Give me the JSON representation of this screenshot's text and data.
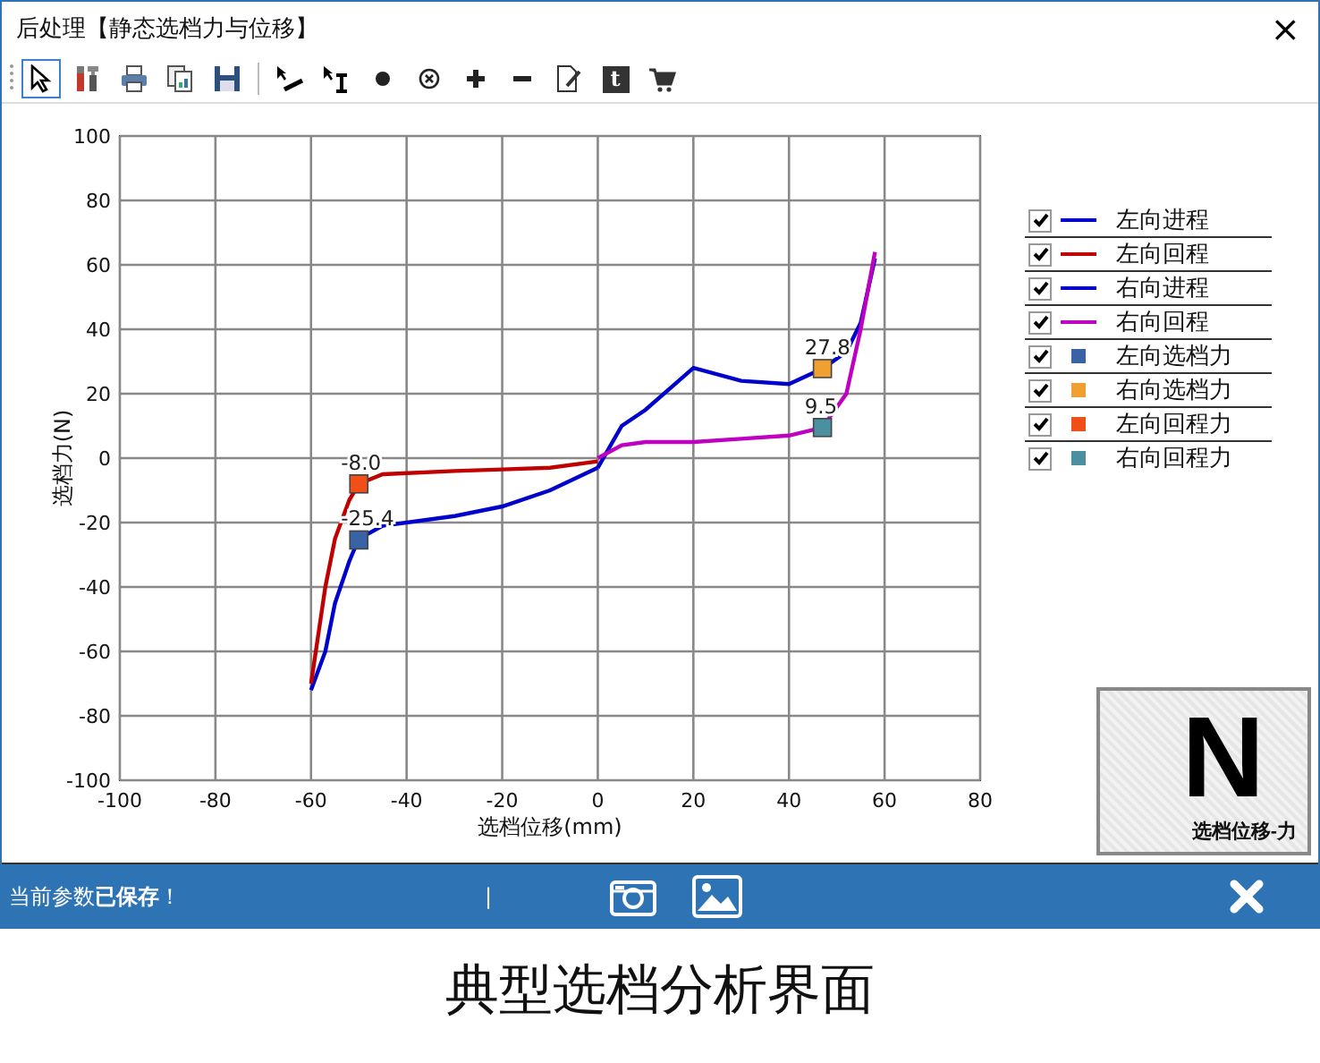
{
  "window": {
    "title": "后处理【静态选档力与位移】",
    "close": "×"
  },
  "toolbar": [
    {
      "kind": "pointer",
      "selected": true
    },
    {
      "kind": "tools",
      "selected": false
    },
    {
      "kind": "print",
      "selected": false
    },
    {
      "kind": "copy",
      "selected": false
    },
    {
      "kind": "save",
      "selected": false
    },
    {
      "kind": "separator"
    },
    {
      "kind": "pick-line",
      "selected": false
    },
    {
      "kind": "pick-cursor",
      "selected": false
    },
    {
      "kind": "dot",
      "selected": false
    },
    {
      "kind": "circle-x",
      "selected": false
    },
    {
      "kind": "plus",
      "selected": false
    },
    {
      "kind": "minus",
      "selected": false
    },
    {
      "kind": "note",
      "selected": false
    },
    {
      "kind": "text",
      "label": "t",
      "selected": false
    },
    {
      "kind": "cart",
      "selected": false
    }
  ],
  "chart": {
    "chart_data": {
      "type": "line",
      "grid": true,
      "xlabel": "选档位移(mm)",
      "ylabel": "选档力(N)",
      "xlim": [
        -100,
        80
      ],
      "ylim": [
        -100,
        100
      ],
      "xticks": [
        -100,
        -80,
        -60,
        -40,
        -20,
        0,
        20,
        40,
        60,
        80
      ],
      "yticks": [
        -100,
        -80,
        -60,
        -40,
        -20,
        0,
        20,
        40,
        60,
        80,
        100
      ],
      "x": [
        -60,
        -57,
        -55,
        -52,
        -50,
        -45,
        -30,
        -20,
        -10,
        0,
        5,
        10,
        20,
        30,
        40,
        47,
        52,
        55,
        58
      ],
      "series": [
        {
          "name": "左向进程",
          "color": "#0000cc",
          "values": [
            -72,
            -60,
            -45,
            -32,
            -25,
            -21,
            -18,
            -15,
            -10,
            -3,
            null,
            null,
            null,
            null,
            null,
            null,
            null,
            null,
            null
          ]
        },
        {
          "name": "左向回程",
          "color": "#c00000",
          "values": [
            -70,
            -40,
            -25,
            -13,
            -8,
            -5,
            -4,
            -3.5,
            -3,
            -1,
            null,
            null,
            null,
            null,
            null,
            null,
            null,
            null,
            null
          ]
        },
        {
          "name": "右向进程",
          "color": "#0000cc",
          "values": [
            null,
            null,
            null,
            null,
            null,
            null,
            null,
            null,
            null,
            -3,
            10,
            15,
            28,
            24,
            23,
            27.8,
            33,
            42,
            62
          ]
        },
        {
          "name": "右向回程",
          "color": "#c000c0",
          "values": [
            null,
            null,
            null,
            null,
            null,
            null,
            null,
            null,
            null,
            0,
            4,
            5,
            5,
            6,
            7,
            9.5,
            20,
            40,
            64
          ]
        },
        {
          "name": "左向选档力",
          "color": "#3a62a6",
          "marker": "square",
          "values": [
            null,
            null,
            null,
            null,
            -25.4,
            null,
            null,
            null,
            null,
            null,
            null,
            null,
            null,
            null,
            null,
            null,
            null,
            null,
            null
          ],
          "value_labels": [
            null,
            null,
            null,
            null,
            "-25.4",
            null,
            null,
            null,
            null,
            null,
            null,
            null,
            null,
            null,
            null,
            null,
            null,
            null,
            null
          ]
        },
        {
          "name": "右向选档力",
          "color": "#f0a030",
          "marker": "square",
          "values": [
            null,
            null,
            null,
            null,
            null,
            null,
            null,
            null,
            null,
            null,
            null,
            null,
            null,
            null,
            null,
            27.8,
            null,
            null,
            null
          ],
          "value_labels": [
            null,
            null,
            null,
            null,
            null,
            null,
            null,
            null,
            null,
            null,
            null,
            null,
            null,
            null,
            null,
            "27.8",
            null,
            null,
            null
          ]
        },
        {
          "name": "左向回程力",
          "color": "#f05018",
          "marker": "square",
          "values": [
            null,
            null,
            null,
            null,
            -8,
            null,
            null,
            null,
            null,
            null,
            null,
            null,
            null,
            null,
            null,
            null,
            null,
            null,
            null
          ],
          "value_labels": [
            null,
            null,
            null,
            null,
            "-8.0",
            null,
            null,
            null,
            null,
            null,
            null,
            null,
            null,
            null,
            null,
            null,
            null,
            null,
            null
          ]
        },
        {
          "name": "右向回程力",
          "color": "#4a90a0",
          "marker": "square",
          "values": [
            null,
            null,
            null,
            null,
            null,
            null,
            null,
            null,
            null,
            null,
            null,
            null,
            null,
            null,
            null,
            9.5,
            null,
            null,
            null
          ],
          "value_labels": [
            null,
            null,
            null,
            null,
            null,
            null,
            null,
            null,
            null,
            null,
            null,
            null,
            null,
            null,
            null,
            "9.5",
            null,
            null,
            null
          ]
        }
      ]
    }
  },
  "legend": [
    {
      "checked": true,
      "kind": "line"
    },
    {
      "checked": true,
      "kind": "line"
    },
    {
      "checked": true,
      "kind": "line"
    },
    {
      "checked": true,
      "kind": "line"
    },
    {
      "checked": true,
      "kind": "square"
    },
    {
      "checked": true,
      "kind": "square"
    },
    {
      "checked": true,
      "kind": "square"
    },
    {
      "checked": true,
      "kind": "square"
    }
  ],
  "mode_button": {
    "letter": "N",
    "label": "选档位移-力"
  },
  "status_bar": {
    "message": "当前参数**已保存**！",
    "separator": "|"
  },
  "caption": "典型选档分析界面"
}
